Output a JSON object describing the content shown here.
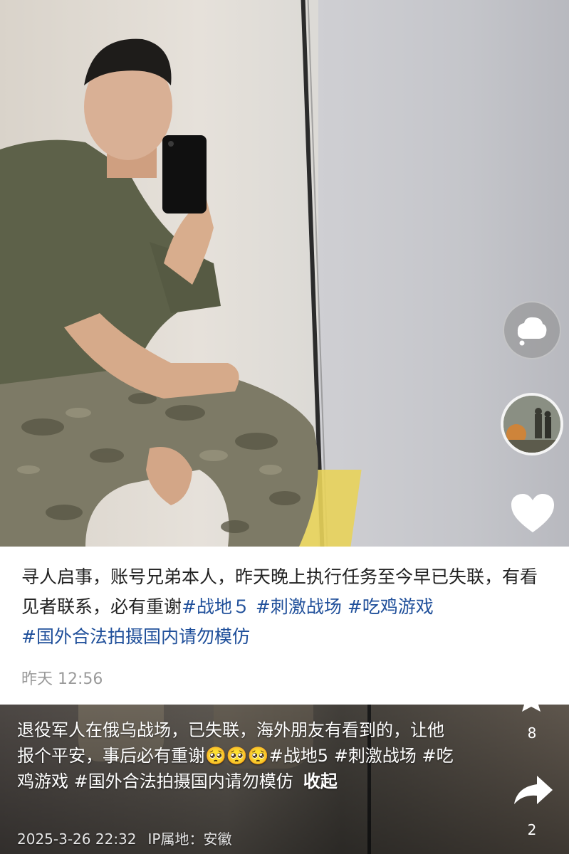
{
  "caption_card": {
    "text_plain": "寻人启事，账号兄弟本人，昨天晚上执行任务至今早已失联，有看见者联系，必有重谢",
    "tags": [
      "#战地５",
      "#刺激战场",
      "#吃鸡游戏",
      "#国外合法拍摄国内请勿模仿"
    ],
    "time": "昨天 12:56"
  },
  "bottom_post": {
    "text_plain": "退役军人在俄乌战场，已失联，海外朋友有看到的，让他报个平安，事后必有重谢",
    "emojis": [
      "🥺",
      "🥺",
      "🥺"
    ],
    "tags": [
      "#战地5",
      "#刺激战场",
      "#吃鸡游戏",
      "#国外合法拍摄国内请勿模仿"
    ],
    "collapse_label": "收起",
    "date": "2025-3-26 22:32",
    "ip_label": "IP属地：安徽"
  },
  "actions": {
    "favorite_count": "8",
    "share_count": "2"
  },
  "icons": {
    "comment": "comment-bubble-icon",
    "music": "music-disc-icon",
    "like": "heart-icon",
    "favorite": "star-icon",
    "share": "share-arrow-icon"
  },
  "colors": {
    "hashtag": "#1f4f9a",
    "caption_text": "#222222",
    "timestamp": "#9a9a9a"
  }
}
